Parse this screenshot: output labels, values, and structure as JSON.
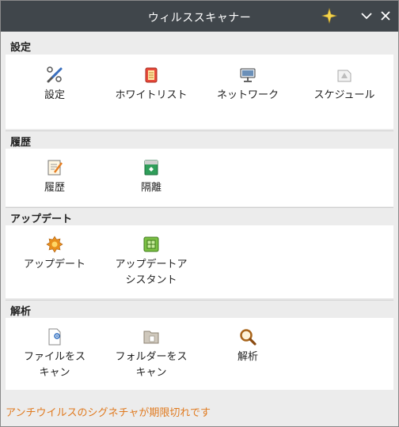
{
  "window": {
    "title": "ウィルススキャナー",
    "titlebar_icons": [
      "sparkle-icon",
      "chevron-down-icon",
      "close-icon"
    ]
  },
  "sections": {
    "settings": {
      "header": "設定",
      "items": [
        {
          "label": "設定",
          "icon": "tools-icon"
        },
        {
          "label": "ホワイトリスト",
          "icon": "whitelist-icon"
        },
        {
          "label": "ネットワーク",
          "icon": "network-icon"
        },
        {
          "label": "スケジュール",
          "icon": "schedule-icon"
        }
      ]
    },
    "history": {
      "header": "履歴",
      "items": [
        {
          "label": "履歴",
          "icon": "history-icon"
        },
        {
          "label": "隔離",
          "icon": "quarantine-icon"
        }
      ]
    },
    "update": {
      "header": "アップデート",
      "items": [
        {
          "label_line1": "アップデート",
          "icon": "update-icon"
        },
        {
          "label_line1": "アップデートア",
          "label_line2": "シスタント",
          "icon": "update-assistant-icon"
        }
      ]
    },
    "analysis": {
      "header": "解析",
      "items": [
        {
          "label_line1": "ファイルをス",
          "label_line2": "キャン",
          "icon": "scan-file-icon"
        },
        {
          "label_line1": "フォルダーをス",
          "label_line2": "キャン",
          "icon": "scan-folder-icon"
        },
        {
          "label_line1": "解析",
          "icon": "magnifier-icon"
        }
      ]
    }
  },
  "status": {
    "message": "アンチウイルスのシグネチャが期限切れです",
    "color": "#e07a1f"
  },
  "colors": {
    "titlebar": "#40464b",
    "panel": "#ffffff",
    "background": "#ececec"
  }
}
